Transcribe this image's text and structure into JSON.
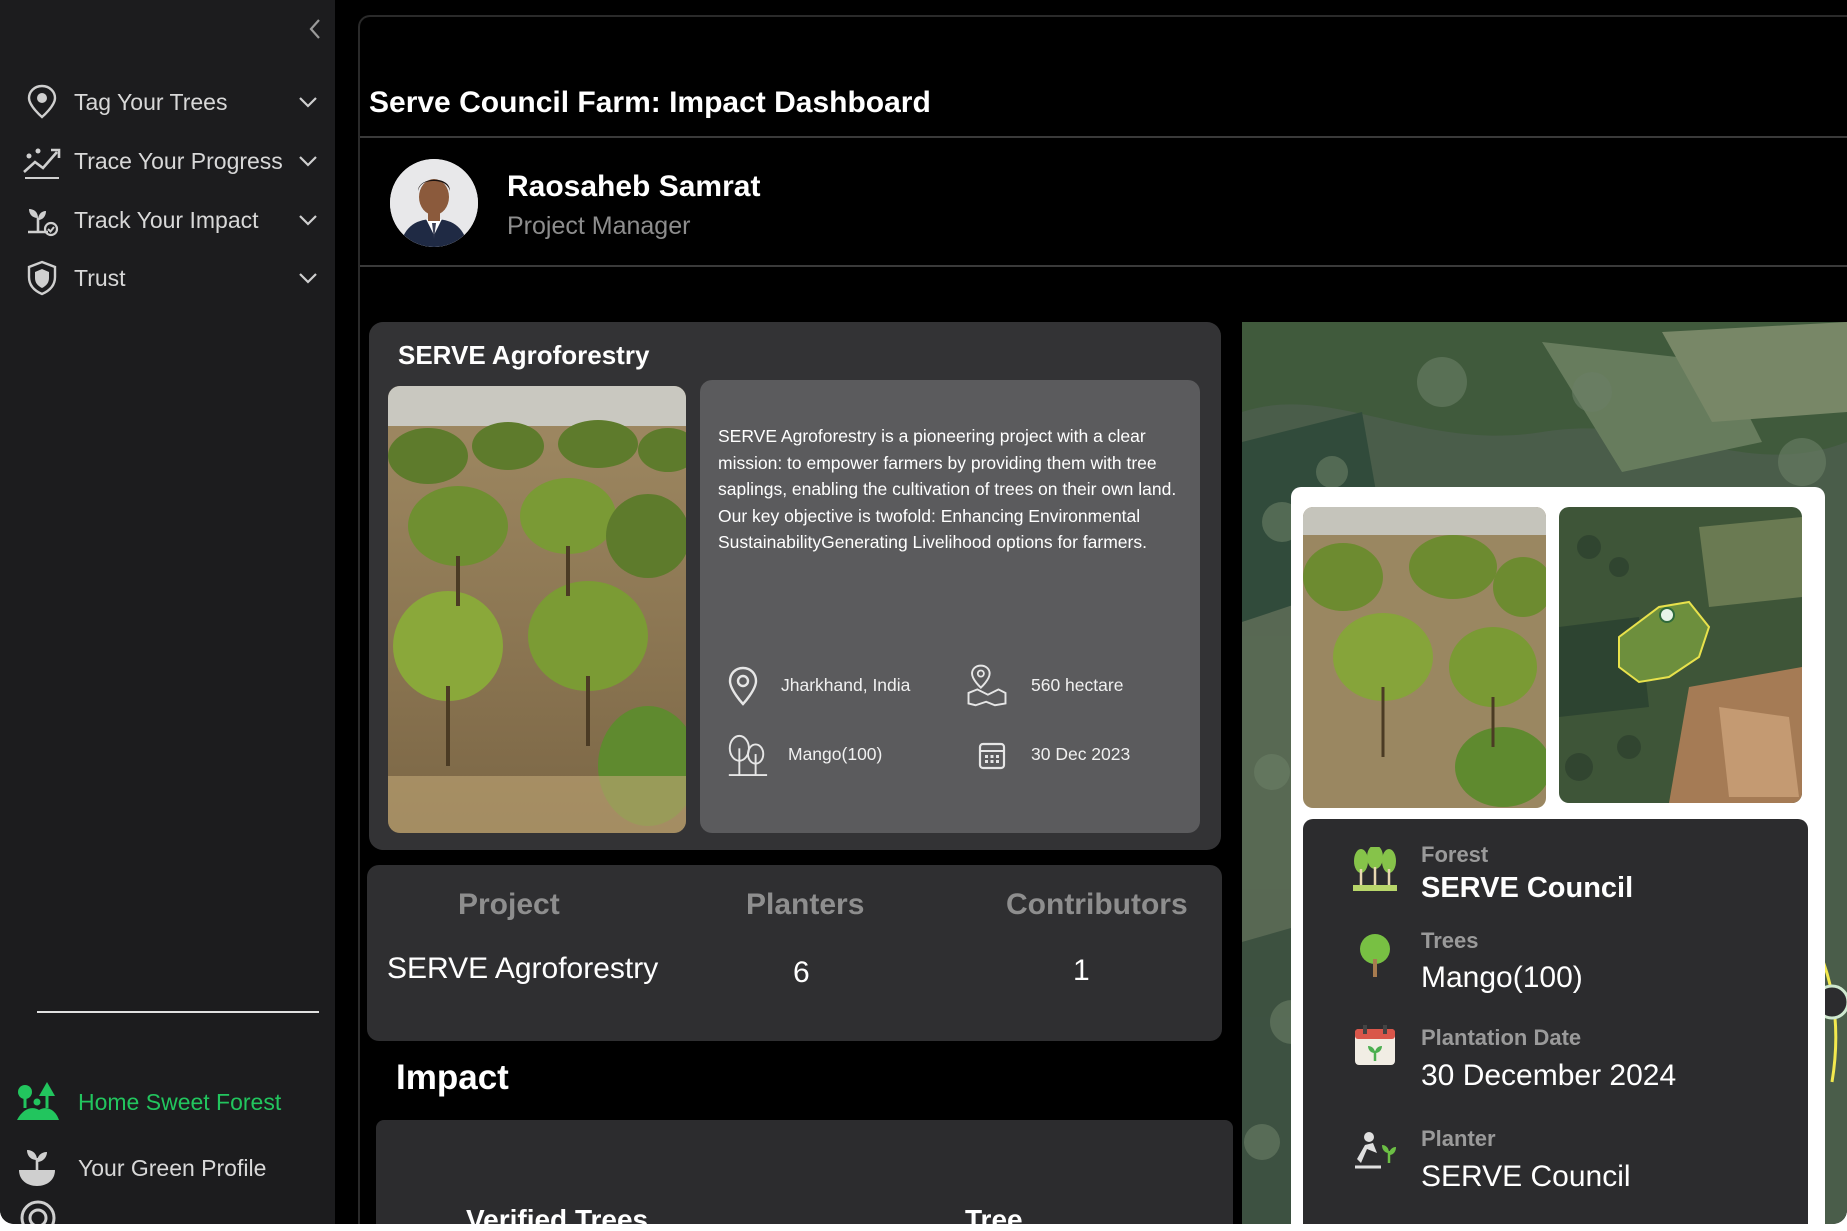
{
  "sidebar": {
    "items": [
      {
        "label": "Tag Your Trees",
        "icon": "map-pin-icon"
      },
      {
        "label": "Trace Your Progress",
        "icon": "progress-chart-icon"
      },
      {
        "label": "Track Your Impact",
        "icon": "seedling-icon"
      },
      {
        "label": "Trust",
        "icon": "shield-icon"
      }
    ],
    "bottom": [
      {
        "label": "Home Sweet Forest",
        "icon": "forest-icon",
        "active": true
      },
      {
        "label": "Your Green Profile",
        "icon": "plant-pot-icon"
      }
    ],
    "active_color": "#22c55e"
  },
  "header": {
    "title": "Serve Council Farm: Impact Dashboard"
  },
  "user": {
    "name": "Raosaheb Samrat",
    "role": "Project Manager"
  },
  "project": {
    "title": "SERVE Agroforestry",
    "description": "SERVE Agroforestry is a pioneering project with a clear mission: to empower farmers by providing them with tree saplings, enabling the cultivation of trees on their own land. Our key objective is twofold: Enhancing Environmental SustainabilityGenerating Livelihood options for farmers.",
    "location": "Jharkhand, India",
    "area": "560 hectare",
    "species": "Mango(100)",
    "date": "30  Dec 2023"
  },
  "stats": {
    "headers": [
      "Project",
      "Planters",
      "Contributors"
    ],
    "values": [
      "SERVE Agroforestry",
      "6",
      "1"
    ]
  },
  "impact": {
    "title": "Impact",
    "columns": [
      "Verified Trees",
      "Tree"
    ]
  },
  "map_popup": {
    "forest_label": "Forest",
    "forest_value": "SERVE Council",
    "trees_label": "Trees",
    "trees_value": "Mango(100)",
    "date_label": "Plantation Date",
    "date_value": "30 December 2024",
    "planter_label": "Planter",
    "planter_value": "SERVE Council"
  }
}
